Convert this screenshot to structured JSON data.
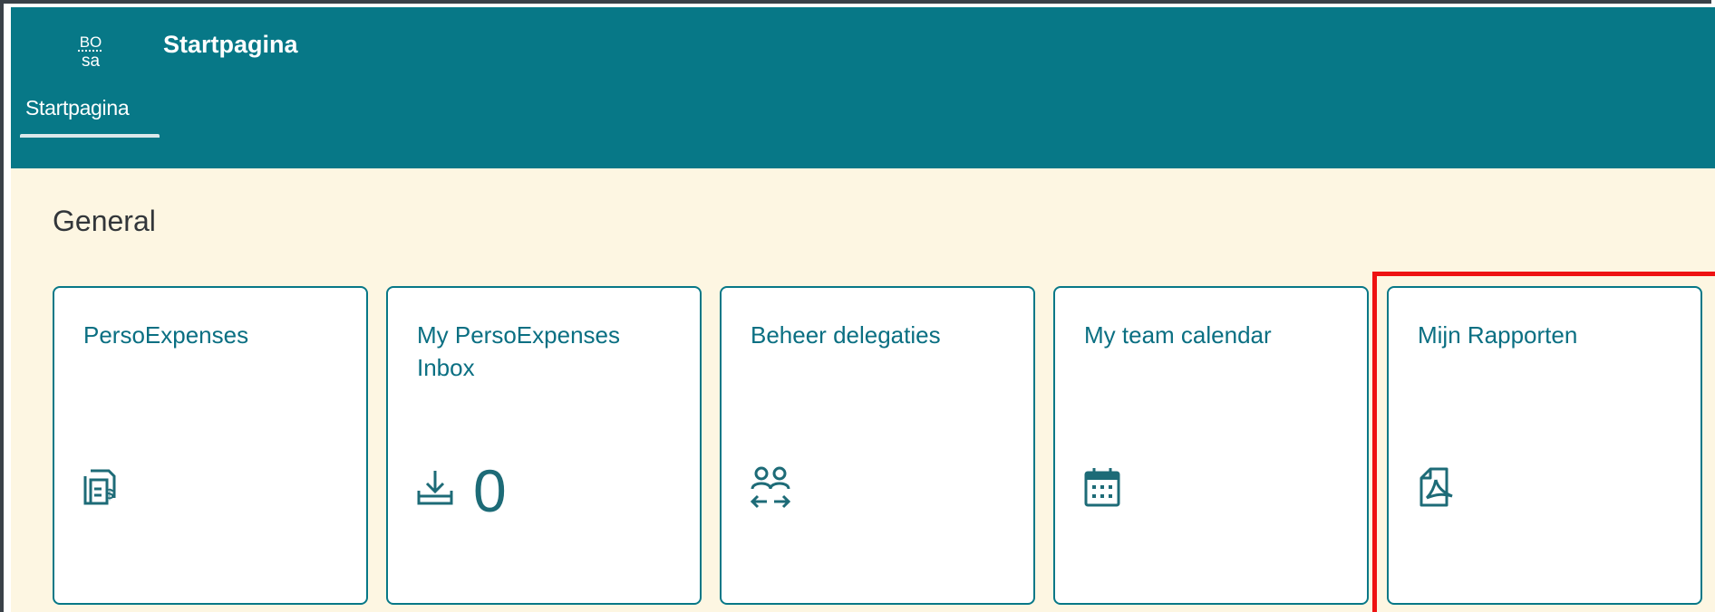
{
  "shell": {
    "logo_text_top": "BO",
    "logo_text_bottom": "sa",
    "title": "Startpagina"
  },
  "tabs": [
    {
      "label": "Startpagina",
      "selected": true
    }
  ],
  "section": {
    "title": "General"
  },
  "tiles": [
    {
      "title": "PersoExpenses",
      "icon": "expense-report-icon"
    },
    {
      "title": "My PersoExpenses Inbox",
      "icon": "inbox-download-icon",
      "count": "0"
    },
    {
      "title": "Beheer delegaties",
      "icon": "delegation-people-icon"
    },
    {
      "title": "My team calendar",
      "icon": "calendar-icon"
    },
    {
      "title": "Mijn Rapporten",
      "icon": "pdf-document-icon",
      "highlighted": true
    }
  ],
  "colors": {
    "shellbar": "#077887",
    "content_bg": "#fdf6e2",
    "tile_border": "#077887",
    "tile_text": "#0a6f82",
    "highlight": "#ee1212"
  }
}
